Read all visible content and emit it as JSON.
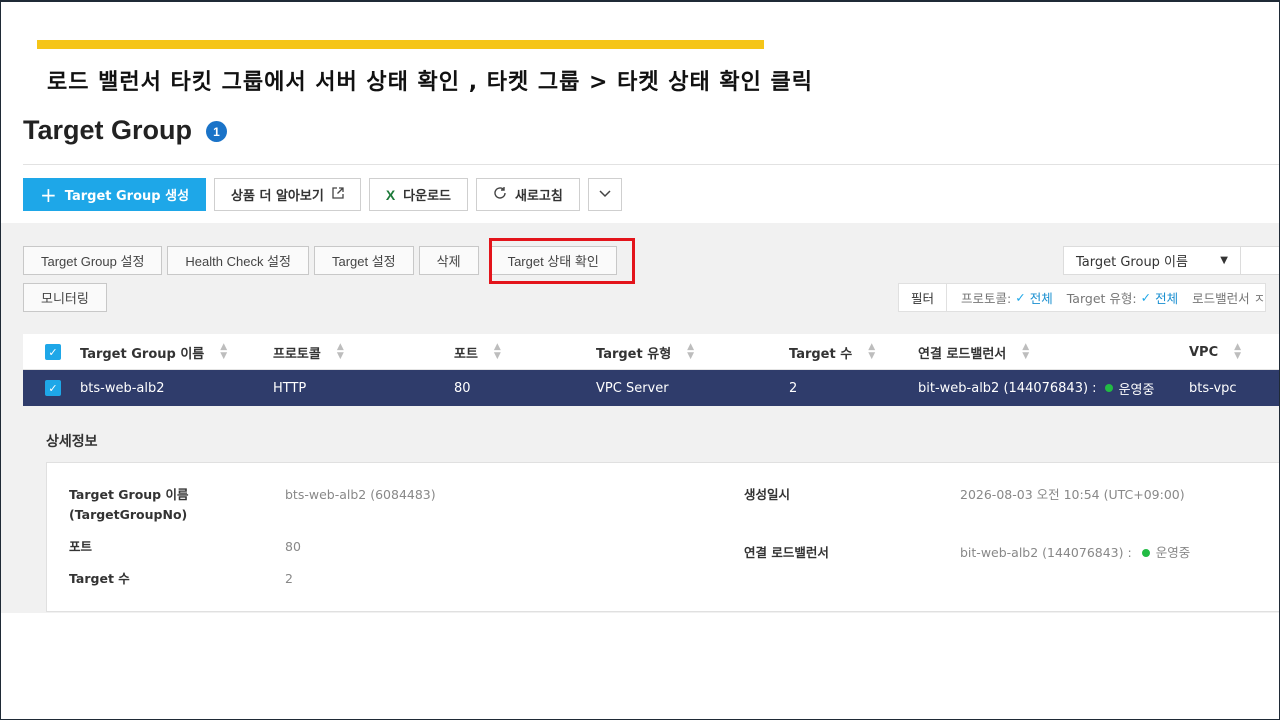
{
  "slide": {
    "title": "로드 밸런서 타킷 그룹에서 서버 상태 확인 , 타켓 그룹 > 타켓 상태 확인 클릭"
  },
  "page": {
    "title": "Target Group",
    "count": "1"
  },
  "toolbar": {
    "create_label": "Target Group 생성",
    "learn_more_label": "상품 더 알아보기",
    "download_label": "다운로드",
    "refresh_label": "새로고침"
  },
  "actions": {
    "tg_settings": "Target Group 설정",
    "health_check": "Health Check 설정",
    "target_settings": "Target 설정",
    "delete": "삭제",
    "target_status": "Target 상태 확인",
    "monitoring": "모니터링"
  },
  "search": {
    "select_value": "Target Group 이름"
  },
  "filter": {
    "button": "필터",
    "protocol_label": "프로토콜:",
    "protocol_value": "전체",
    "type_label": "Target 유형:",
    "type_value": "전체",
    "lb_label": "로드밸런서 ㅈ"
  },
  "table": {
    "headers": {
      "name": "Target Group 이름",
      "protocol": "프로토콜",
      "port": "포트",
      "type": "Target 유형",
      "count": "Target 수",
      "lb": "연결 로드밸런서",
      "vpc": "VPC"
    },
    "rows": [
      {
        "name": "bts-web-alb2",
        "protocol": "HTTP",
        "port": "80",
        "type": "VPC Server",
        "count": "2",
        "lb": "bit-web-alb2 (144076843) :",
        "lb_status": "운영중",
        "vpc": "bts-vpc"
      }
    ]
  },
  "detail": {
    "title": "상세정보",
    "name_label": "Target Group 이름",
    "name_label_sub": "(TargetGroupNo)",
    "name_value": "bts-web-alb2 (6084483)",
    "port_label": "포트",
    "port_value": "80",
    "count_label": "Target 수",
    "count_value": "2",
    "created_label": "생성일시",
    "created_value": "2026-08-03 오전 10:54 (UTC+09:00)",
    "lb_label": "연결 로드밸런서",
    "lb_value": "bit-web-alb2 (144076843) :",
    "lb_status": "운영중"
  },
  "colors": {
    "accent": "#1ea7e8",
    "selected_row": "#2f3c6b",
    "highlight": "#e3141b",
    "status_ok": "#22bb44",
    "slide_bar": "#f5c518"
  }
}
